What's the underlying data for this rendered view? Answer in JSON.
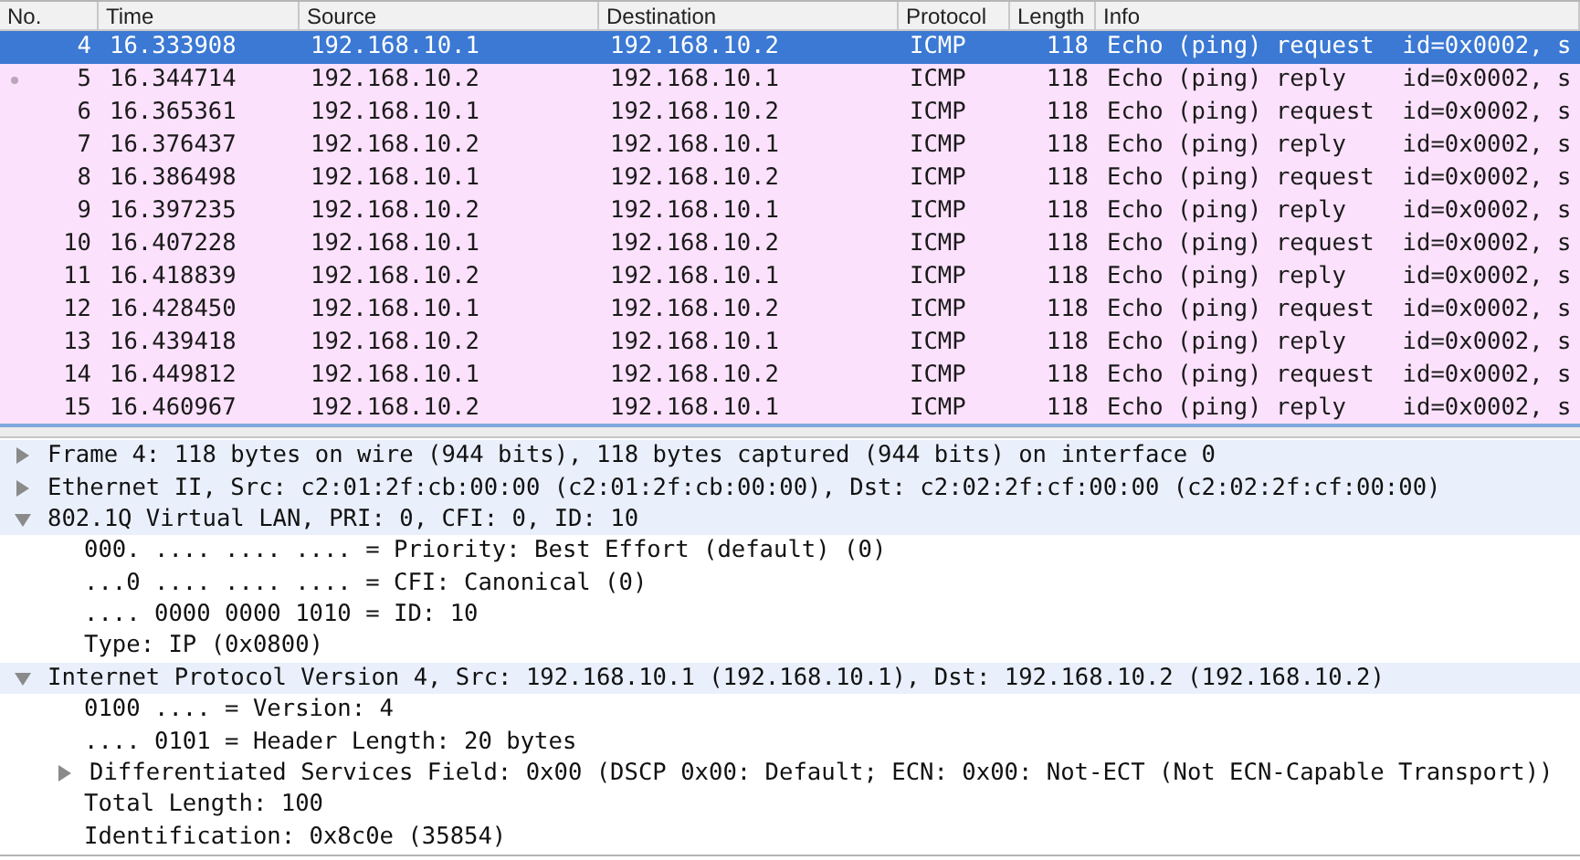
{
  "packet_list": {
    "columns": [
      "No.",
      "Time",
      "Source",
      "Destination",
      "Protocol",
      "Length",
      "Info"
    ],
    "rows": [
      {
        "cells": [
          "4",
          "16.333908",
          "192.168.10.1",
          "192.168.10.2",
          "ICMP",
          "118",
          "Echo (ping) request  id=0x0002, s"
        ],
        "selected": true,
        "related": false
      },
      {
        "cells": [
          "5",
          "16.344714",
          "192.168.10.2",
          "192.168.10.1",
          "ICMP",
          "118",
          "Echo (ping) reply    id=0x0002, s"
        ],
        "selected": false,
        "related": true
      },
      {
        "cells": [
          "6",
          "16.365361",
          "192.168.10.1",
          "192.168.10.2",
          "ICMP",
          "118",
          "Echo (ping) request  id=0x0002, s"
        ],
        "selected": false,
        "related": false
      },
      {
        "cells": [
          "7",
          "16.376437",
          "192.168.10.2",
          "192.168.10.1",
          "ICMP",
          "118",
          "Echo (ping) reply    id=0x0002, s"
        ],
        "selected": false,
        "related": false
      },
      {
        "cells": [
          "8",
          "16.386498",
          "192.168.10.1",
          "192.168.10.2",
          "ICMP",
          "118",
          "Echo (ping) request  id=0x0002, s"
        ],
        "selected": false,
        "related": false
      },
      {
        "cells": [
          "9",
          "16.397235",
          "192.168.10.2",
          "192.168.10.1",
          "ICMP",
          "118",
          "Echo (ping) reply    id=0x0002, s"
        ],
        "selected": false,
        "related": false
      },
      {
        "cells": [
          "10",
          "16.407228",
          "192.168.10.1",
          "192.168.10.2",
          "ICMP",
          "118",
          "Echo (ping) request  id=0x0002, s"
        ],
        "selected": false,
        "related": false
      },
      {
        "cells": [
          "11",
          "16.418839",
          "192.168.10.2",
          "192.168.10.1",
          "ICMP",
          "118",
          "Echo (ping) reply    id=0x0002, s"
        ],
        "selected": false,
        "related": false
      },
      {
        "cells": [
          "12",
          "16.428450",
          "192.168.10.1",
          "192.168.10.2",
          "ICMP",
          "118",
          "Echo (ping) request  id=0x0002, s"
        ],
        "selected": false,
        "related": false
      },
      {
        "cells": [
          "13",
          "16.439418",
          "192.168.10.2",
          "192.168.10.1",
          "ICMP",
          "118",
          "Echo (ping) reply    id=0x0002, s"
        ],
        "selected": false,
        "related": false
      },
      {
        "cells": [
          "14",
          "16.449812",
          "192.168.10.1",
          "192.168.10.2",
          "ICMP",
          "118",
          "Echo (ping) request  id=0x0002, s"
        ],
        "selected": false,
        "related": false
      },
      {
        "cells": [
          "15",
          "16.460967",
          "192.168.10.2",
          "192.168.10.1",
          "ICMP",
          "118",
          "Echo (ping) reply    id=0x0002, s"
        ],
        "selected": false,
        "related": false
      }
    ]
  },
  "packet_details": [
    {
      "text": "Frame 4: 118 bytes on wire (944 bits), 118 bytes captured (944 bits) on interface 0",
      "expanded": false
    },
    {
      "text": "Ethernet II, Src: c2:01:2f:cb:00:00 (c2:01:2f:cb:00:00), Dst: c2:02:2f:cf:00:00 (c2:02:2f:cf:00:00)",
      "expanded": false
    },
    {
      "text": "802.1Q Virtual LAN, PRI: 0, CFI: 0, ID: 10",
      "expanded": true,
      "children": [
        {
          "text": "000. .... .... .... = Priority: Best Effort (default) (0)"
        },
        {
          "text": "...0 .... .... .... = CFI: Canonical (0)"
        },
        {
          "text": ".... 0000 0000 1010 = ID: 10"
        },
        {
          "text": "Type: IP (0x0800)"
        }
      ]
    },
    {
      "text": "Internet Protocol Version 4, Src: 192.168.10.1 (192.168.10.1), Dst: 192.168.10.2 (192.168.10.2)",
      "expanded": true,
      "children": [
        {
          "text": "0100 .... = Version: 4"
        },
        {
          "text": ".... 0101 = Header Length: 20 bytes"
        },
        {
          "text": "Differentiated Services Field: 0x00 (DSCP 0x00: Default; ECN: 0x00: Not-ECT (Not ECN-Capable Transport))",
          "expanded": false
        },
        {
          "text": "Total Length: 100"
        },
        {
          "text": "Identification: 0x8c0e (35854)"
        }
      ]
    }
  ]
}
